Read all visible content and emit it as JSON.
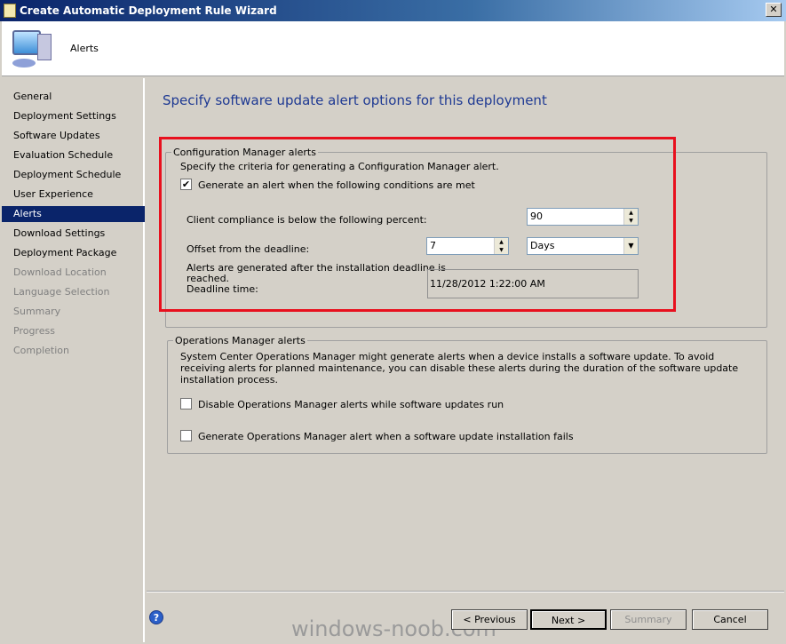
{
  "window": {
    "title": "Create Automatic Deployment Rule Wizard",
    "close": "✕"
  },
  "header": {
    "page": "Alerts"
  },
  "sidebar": {
    "items": [
      {
        "label": "General",
        "state": "normal"
      },
      {
        "label": "Deployment Settings",
        "state": "normal"
      },
      {
        "label": "Software Updates",
        "state": "normal"
      },
      {
        "label": "Evaluation Schedule",
        "state": "normal"
      },
      {
        "label": "Deployment Schedule",
        "state": "normal"
      },
      {
        "label": "User Experience",
        "state": "normal"
      },
      {
        "label": "Alerts",
        "state": "selected"
      },
      {
        "label": "Download Settings",
        "state": "normal"
      },
      {
        "label": "Deployment Package",
        "state": "normal"
      },
      {
        "label": "Download Location",
        "state": "disabled"
      },
      {
        "label": "Language Selection",
        "state": "disabled"
      },
      {
        "label": "Summary",
        "state": "disabled"
      },
      {
        "label": "Progress",
        "state": "disabled"
      },
      {
        "label": "Completion",
        "state": "disabled"
      }
    ]
  },
  "main": {
    "heading": "Specify software update alert options for this deployment",
    "cm": {
      "legend": "Configuration Manager alerts",
      "desc": "Specify the criteria for generating a Configuration Manager alert.",
      "generate_label": "Generate an alert when the following conditions are met",
      "generate_checked": true,
      "compliance_label": "Client compliance is below the  following percent:",
      "compliance_value": "90",
      "offset_label": "Offset from the deadline:",
      "offset_value": "7",
      "offset_unit": "Days",
      "deadline_label_1": "Alerts are generated after the installation deadline is",
      "deadline_label_2": "reached.",
      "deadline_label_3": "Deadline time:",
      "deadline_value": "11/28/2012 1:22:00 AM"
    },
    "om": {
      "legend": "Operations Manager alerts",
      "desc": "System Center Operations Manager might generate alerts when a device installs a software update. To avoid receiving alerts for planned maintenance, you can disable these alerts during the duration of the software update installation process.",
      "disable_label": "Disable Operations Manager alerts while software updates run",
      "generate_label": "Generate Operations Manager alert when a software update installation fails"
    }
  },
  "footer": {
    "previous": "< Previous",
    "next": "Next >",
    "summary": "Summary",
    "cancel": "Cancel",
    "help": "?"
  },
  "watermark": "windows-noob.com",
  "colors": {
    "highlight": "#e8101e",
    "heading": "#1f3a93",
    "selected": "#0a246a"
  }
}
